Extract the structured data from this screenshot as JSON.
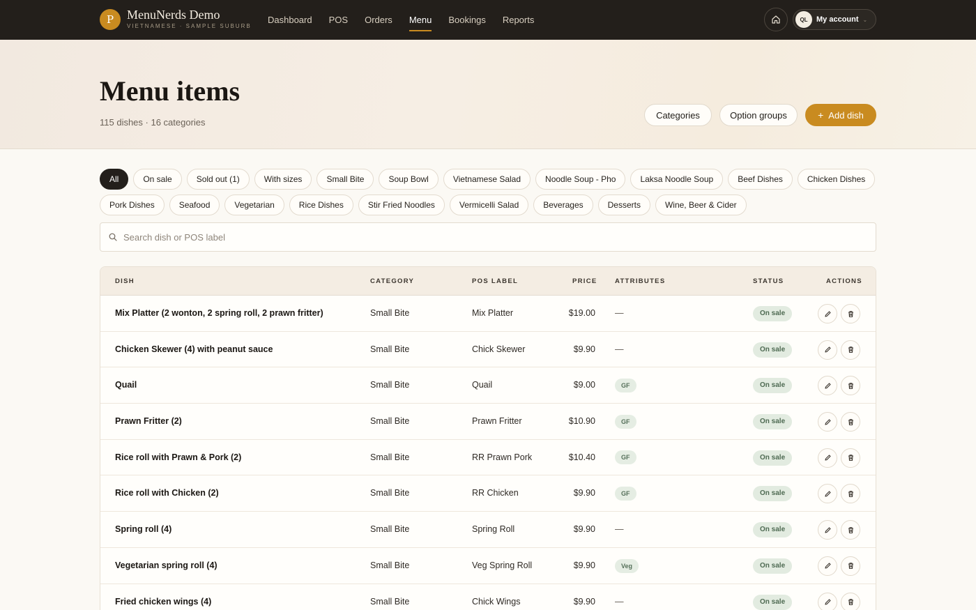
{
  "brand": {
    "logo_letter": "P",
    "title": "MenuNerds Demo",
    "subtitle": "VIETNAMESE · SAMPLE SUBURB"
  },
  "nav": [
    {
      "label": "Dashboard",
      "active": false
    },
    {
      "label": "POS",
      "active": false
    },
    {
      "label": "Orders",
      "active": false
    },
    {
      "label": "Menu",
      "active": true
    },
    {
      "label": "Bookings",
      "active": false
    },
    {
      "label": "Reports",
      "active": false
    }
  ],
  "account": {
    "initials": "QL",
    "label": "My account"
  },
  "page": {
    "title": "Menu items",
    "subtitle": "115 dishes · 16 categories"
  },
  "header_buttons": {
    "categories": "Categories",
    "option_groups": "Option groups",
    "add_dish": "Add dish"
  },
  "filters": {
    "row1": [
      "All",
      "On sale",
      "Sold out (1)",
      "With sizes",
      "Small Bite",
      "Soup Bowl",
      "Vietnamese Salad",
      "Noodle Soup - Pho",
      "Laksa Noodle Soup",
      "Beef Dishes",
      "Chicken Dishes"
    ],
    "row2": [
      "Pork Dishes",
      "Seafood",
      "Vegetarian",
      "Rice Dishes",
      "Stir Fried Noodles",
      "Vermicelli Salad",
      "Beverages",
      "Desserts",
      "Wine, Beer & Cider"
    ],
    "active": "All"
  },
  "search": {
    "placeholder": "Search dish or POS label",
    "value": ""
  },
  "table": {
    "headers": {
      "dish": "DISH",
      "category": "CATEGORY",
      "pos_label": "POS LABEL",
      "price": "PRICE",
      "attributes": "ATTRIBUTES",
      "status": "STATUS",
      "actions": "ACTIONS"
    },
    "rows": [
      {
        "dish": "Mix Platter (2 wonton, 2 spring roll, 2 prawn fritter)",
        "category": "Small Bite",
        "pos_label": "Mix Platter",
        "price": "$19.00",
        "attribute": "—",
        "status": "On sale"
      },
      {
        "dish": "Chicken Skewer (4) with peanut sauce",
        "category": "Small Bite",
        "pos_label": "Chick Skewer",
        "price": "$9.90",
        "attribute": "—",
        "status": "On sale"
      },
      {
        "dish": "Quail",
        "category": "Small Bite",
        "pos_label": "Quail",
        "price": "$9.00",
        "attribute": "GF",
        "status": "On sale"
      },
      {
        "dish": "Prawn Fritter (2)",
        "category": "Small Bite",
        "pos_label": "Prawn Fritter",
        "price": "$10.90",
        "attribute": "GF",
        "status": "On sale"
      },
      {
        "dish": "Rice roll with Prawn & Pork (2)",
        "category": "Small Bite",
        "pos_label": "RR Prawn Pork",
        "price": "$10.40",
        "attribute": "GF",
        "status": "On sale"
      },
      {
        "dish": "Rice roll with Chicken (2)",
        "category": "Small Bite",
        "pos_label": "RR Chicken",
        "price": "$9.90",
        "attribute": "GF",
        "status": "On sale"
      },
      {
        "dish": "Spring roll (4)",
        "category": "Small Bite",
        "pos_label": "Spring Roll",
        "price": "$9.90",
        "attribute": "—",
        "status": "On sale"
      },
      {
        "dish": "Vegetarian spring roll (4)",
        "category": "Small Bite",
        "pos_label": "Veg Spring Roll",
        "price": "$9.90",
        "attribute": "Veg",
        "status": "On sale"
      },
      {
        "dish": "Fried chicken wings (4)",
        "category": "Small Bite",
        "pos_label": "Chick Wings",
        "price": "$9.90",
        "attribute": "—",
        "status": "On sale"
      }
    ]
  },
  "icons": {
    "home": "home-icon",
    "chevron": "chevron-down-icon",
    "plus": "plus-icon",
    "search": "search-icon",
    "edit": "pencil-icon",
    "delete": "trash-icon"
  },
  "colors": {
    "topbar": "#231f1b",
    "accent": "#c98b20",
    "status_bg": "#e2ebe0",
    "status_text": "#4e6a52"
  }
}
